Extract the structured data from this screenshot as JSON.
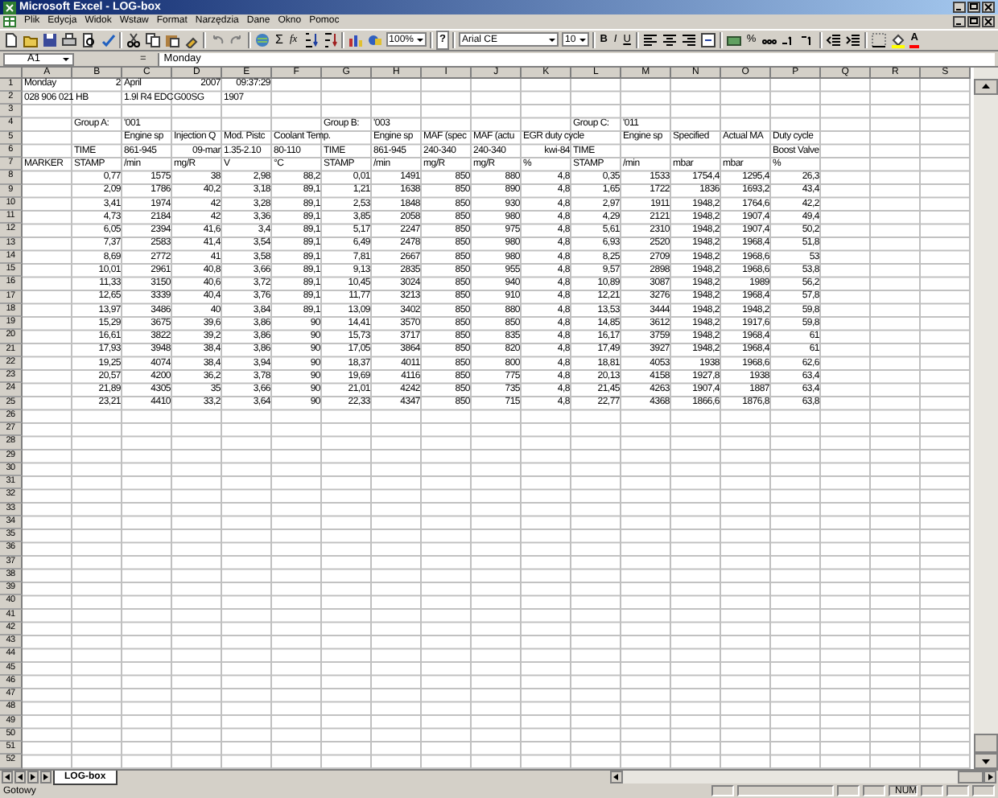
{
  "window": {
    "title": "Microsoft Excel - LOG-box"
  },
  "menu": [
    "Plik",
    "Edycja",
    "Widok",
    "Wstaw",
    "Format",
    "Narzędzia",
    "Dane",
    "Okno",
    "Pomoc"
  ],
  "toolbar": {
    "sum": "Σ",
    "function": "fx",
    "zoom": "100%",
    "help": "?",
    "font": "Arial CE",
    "size": "10",
    "style_buttons": [
      "B",
      "I",
      "U"
    ],
    "percent": "%",
    "font_color": "A"
  },
  "formula_bar": {
    "name_box": "A1",
    "equals": "=",
    "value": "Monday"
  },
  "columns": [
    "A",
    "B",
    "C",
    "D",
    "E",
    "F",
    "G",
    "H",
    "I",
    "J",
    "K",
    "L",
    "M",
    "N",
    "O",
    "P",
    "Q",
    "R",
    "S"
  ],
  "rows": [
    {
      "n": "1",
      "cells": {
        "a": {
          "text": "Monday"
        },
        "b": {
          "text": "2",
          "numeric": true
        },
        "c": {
          "text": "April"
        },
        "d": {
          "text": "2007",
          "numeric": true
        },
        "e": {
          "text": "09:37:29",
          "numeric": true
        }
      }
    },
    {
      "n": "2",
      "cells": {
        "a": {
          "text": "028 906 021 HB"
        },
        "c": {
          "text": "1.9l R4 EDC"
        },
        "d": {
          "text": "G00SG"
        },
        "e": {
          "text": "1907"
        }
      }
    },
    {
      "n": "3"
    },
    {
      "n": "4",
      "cells": {
        "b": {
          "text": "Group A:"
        },
        "c": {
          "text": "'001"
        },
        "g": {
          "text": "Group B:"
        },
        "h": {
          "text": "'003"
        },
        "l": {
          "text": "Group C:"
        },
        "m": {
          "text": "'011"
        }
      }
    },
    {
      "n": "5",
      "cells": {
        "c": {
          "text": "Engine sp"
        },
        "d": {
          "text": "Injection Q"
        },
        "e": {
          "text": "Mod. Pistc"
        },
        "f": {
          "text": "Coolant Temp."
        },
        "h": {
          "text": "Engine sp"
        },
        "i": {
          "text": "MAF (spec"
        },
        "j": {
          "text": "MAF (actu"
        },
        "k": {
          "text": "EGR duty cycle"
        },
        "m": {
          "text": "Engine sp"
        },
        "n": {
          "text": "Specified"
        },
        "o": {
          "text": "Actual MA"
        },
        "p": {
          "text": "Duty cycle"
        }
      }
    },
    {
      "n": "6",
      "cells": {
        "b": {
          "text": "TIME"
        },
        "c": {
          "text": "861-945"
        },
        "d": {
          "text": "09-mar",
          "numeric": true
        },
        "e": {
          "text": "1.35-2.10"
        },
        "f": {
          "text": "80-110"
        },
        "g": {
          "text": "TIME"
        },
        "h": {
          "text": "861-945"
        },
        "i": {
          "text": "240-340"
        },
        "j": {
          "text": "240-340"
        },
        "k": {
          "text": "kwi-84",
          "numeric": true
        },
        "l": {
          "text": "TIME"
        },
        "p": {
          "text": "Boost Valve"
        }
      }
    },
    {
      "n": "7",
      "cells": {
        "a": {
          "text": "MARKER"
        },
        "b": {
          "text": "STAMP"
        },
        "c": {
          "text": "/min"
        },
        "d": {
          "text": "mg/R"
        },
        "e": {
          "text": "V"
        },
        "f": {
          "text": "°C"
        },
        "g": {
          "text": "STAMP"
        },
        "h": {
          "text": "/min"
        },
        "i": {
          "text": "mg/R"
        },
        "j": {
          "text": "mg/R"
        },
        "k": {
          "text": "%"
        },
        "l": {
          "text": "STAMP"
        },
        "m": {
          "text": "/min"
        },
        "n": {
          "text": "mbar"
        },
        "o": {
          "text": "mbar"
        },
        "p": {
          "text": "%"
        }
      }
    },
    {
      "n": "8",
      "values": [
        "0,77",
        "1575",
        "38",
        "2,98",
        "88,2",
        "0,01",
        "1491",
        "850",
        "880",
        "4,8",
        "0,35",
        "1533",
        "1754,4",
        "1295,4",
        "26,3"
      ]
    },
    {
      "n": "9",
      "values": [
        "2,09",
        "1786",
        "40,2",
        "3,18",
        "89,1",
        "1,21",
        "1638",
        "850",
        "890",
        "4,8",
        "1,65",
        "1722",
        "1836",
        "1693,2",
        "43,4"
      ]
    },
    {
      "n": "10",
      "values": [
        "3,41",
        "1974",
        "42",
        "3,28",
        "89,1",
        "2,53",
        "1848",
        "850",
        "930",
        "4,8",
        "2,97",
        "1911",
        "1948,2",
        "1764,6",
        "42,2"
      ]
    },
    {
      "n": "11",
      "values": [
        "4,73",
        "2184",
        "42",
        "3,36",
        "89,1",
        "3,85",
        "2058",
        "850",
        "980",
        "4,8",
        "4,29",
        "2121",
        "1948,2",
        "1907,4",
        "49,4"
      ]
    },
    {
      "n": "12",
      "values": [
        "6,05",
        "2394",
        "41,6",
        "3,4",
        "89,1",
        "5,17",
        "2247",
        "850",
        "975",
        "4,8",
        "5,61",
        "2310",
        "1948,2",
        "1907,4",
        "50,2"
      ]
    },
    {
      "n": "13",
      "values": [
        "7,37",
        "2583",
        "41,4",
        "3,54",
        "89,1",
        "6,49",
        "2478",
        "850",
        "980",
        "4,8",
        "6,93",
        "2520",
        "1948,2",
        "1968,4",
        "51,8"
      ]
    },
    {
      "n": "14",
      "values": [
        "8,69",
        "2772",
        "41",
        "3,58",
        "89,1",
        "7,81",
        "2667",
        "850",
        "980",
        "4,8",
        "8,25",
        "2709",
        "1948,2",
        "1968,6",
        "53"
      ]
    },
    {
      "n": "15",
      "values": [
        "10,01",
        "2961",
        "40,8",
        "3,66",
        "89,1",
        "9,13",
        "2835",
        "850",
        "955",
        "4,8",
        "9,57",
        "2898",
        "1948,2",
        "1968,6",
        "53,8"
      ]
    },
    {
      "n": "16",
      "values": [
        "11,33",
        "3150",
        "40,6",
        "3,72",
        "89,1",
        "10,45",
        "3024",
        "850",
        "940",
        "4,8",
        "10,89",
        "3087",
        "1948,2",
        "1989",
        "56,2"
      ]
    },
    {
      "n": "17",
      "values": [
        "12,65",
        "3339",
        "40,4",
        "3,76",
        "89,1",
        "11,77",
        "3213",
        "850",
        "910",
        "4,8",
        "12,21",
        "3276",
        "1948,2",
        "1968,4",
        "57,8"
      ]
    },
    {
      "n": "18",
      "values": [
        "13,97",
        "3486",
        "40",
        "3,84",
        "89,1",
        "13,09",
        "3402",
        "850",
        "880",
        "4,8",
        "13,53",
        "3444",
        "1948,2",
        "1948,2",
        "59,8"
      ]
    },
    {
      "n": "19",
      "values": [
        "15,29",
        "3675",
        "39,6",
        "3,86",
        "90",
        "14,41",
        "3570",
        "850",
        "850",
        "4,8",
        "14,85",
        "3612",
        "1948,2",
        "1917,6",
        "59,8"
      ]
    },
    {
      "n": "20",
      "values": [
        "16,61",
        "3822",
        "39,2",
        "3,86",
        "90",
        "15,73",
        "3717",
        "850",
        "835",
        "4,8",
        "16,17",
        "3759",
        "1948,2",
        "1968,4",
        "61"
      ]
    },
    {
      "n": "21",
      "values": [
        "17,93",
        "3948",
        "38,4",
        "3,86",
        "90",
        "17,05",
        "3864",
        "850",
        "820",
        "4,8",
        "17,49",
        "3927",
        "1948,2",
        "1968,4",
        "61"
      ]
    },
    {
      "n": "22",
      "values": [
        "19,25",
        "4074",
        "38,4",
        "3,94",
        "90",
        "18,37",
        "4011",
        "850",
        "800",
        "4,8",
        "18,81",
        "4053",
        "1938",
        "1968,6",
        "62,6"
      ]
    },
    {
      "n": "23",
      "values": [
        "20,57",
        "4200",
        "36,2",
        "3,78",
        "90",
        "19,69",
        "4116",
        "850",
        "775",
        "4,8",
        "20,13",
        "4158",
        "1927,8",
        "1938",
        "63,4"
      ]
    },
    {
      "n": "24",
      "values": [
        "21,89",
        "4305",
        "35",
        "3,66",
        "90",
        "21,01",
        "4242",
        "850",
        "735",
        "4,8",
        "21,45",
        "4263",
        "1907,4",
        "1887",
        "63,4"
      ]
    },
    {
      "n": "25",
      "values": [
        "23,21",
        "4410",
        "33,2",
        "3,64",
        "90",
        "22,33",
        "4347",
        "850",
        "715",
        "4,8",
        "22,77",
        "4368",
        "1866,6",
        "1876,8",
        "63,8"
      ]
    },
    {
      "n": "26"
    },
    {
      "n": "27"
    },
    {
      "n": "28"
    },
    {
      "n": "29"
    },
    {
      "n": "30"
    },
    {
      "n": "31"
    },
    {
      "n": "32"
    },
    {
      "n": "33"
    },
    {
      "n": "34"
    },
    {
      "n": "35"
    },
    {
      "n": "36"
    },
    {
      "n": "37"
    },
    {
      "n": "38"
    },
    {
      "n": "39"
    },
    {
      "n": "40"
    },
    {
      "n": "41"
    },
    {
      "n": "42"
    },
    {
      "n": "43"
    },
    {
      "n": "44"
    },
    {
      "n": "45"
    },
    {
      "n": "46"
    },
    {
      "n": "47"
    },
    {
      "n": "48"
    },
    {
      "n": "49"
    },
    {
      "n": "50"
    },
    {
      "n": "51"
    },
    {
      "n": "52"
    }
  ],
  "sheet_tabs": [
    {
      "label": "LOG-box",
      "selected": true
    }
  ],
  "status_bar": {
    "text": "Gotowy",
    "indicator": "NUM"
  }
}
